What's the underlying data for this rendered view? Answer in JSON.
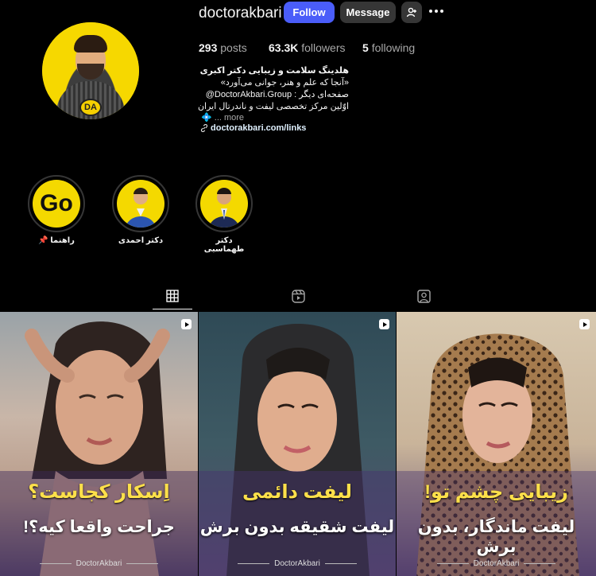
{
  "profile": {
    "username": "doctorakbari",
    "follow_label": "Follow",
    "message_label": "Message",
    "posts_count": "293",
    "posts_label": "posts",
    "followers_count": "63.3K",
    "followers_label": "followers",
    "following_count": "5",
    "following_label": "following",
    "bio_name": "هلدینگ سلامت و زیبایی دکتر اکبری",
    "bio_line1": "«آنجا که علم و هنر، جوانی می‌آورد»",
    "bio_line2": "صفحه‌ای دیگر : DoctorAkbari.Group@",
    "bio_line3": "اوّلین مرکز تخصصی لیفت و ناندرتال ایران",
    "bio_more_glyph": "💠",
    "bio_more": "... more",
    "link": "doctorakbari.com/links",
    "avatar_logo": "DA"
  },
  "highlights": [
    {
      "label": "راهنما 📌",
      "cover_text": "Go"
    },
    {
      "label": "دکتر احمدی"
    },
    {
      "label": "دکتر طهماسبی"
    }
  ],
  "tabs": [
    {
      "icon": "grid-icon",
      "active": true
    },
    {
      "icon": "reels-icon",
      "active": false
    },
    {
      "icon": "tagged-icon",
      "active": false
    }
  ],
  "posts": [
    {
      "title": "اِسکار کجاست؟",
      "subtitle": "جراحت واقعا کیه؟!",
      "brand": "DoctorAkbari"
    },
    {
      "title": "لیفت دائمی",
      "subtitle": "لیفت شقیقه بدون برش",
      "brand": "DoctorAkbari"
    },
    {
      "title": "زیبایی چشم تو!",
      "subtitle": "لیفت ماندگار، بدون برش",
      "brand": "DoctorAkbari"
    }
  ],
  "colors": {
    "background": "#000000",
    "follow_button": "#4a5df9",
    "secondary_button": "#363636",
    "post_title": "#fde04a",
    "highlight_cover": "#f4d900"
  }
}
